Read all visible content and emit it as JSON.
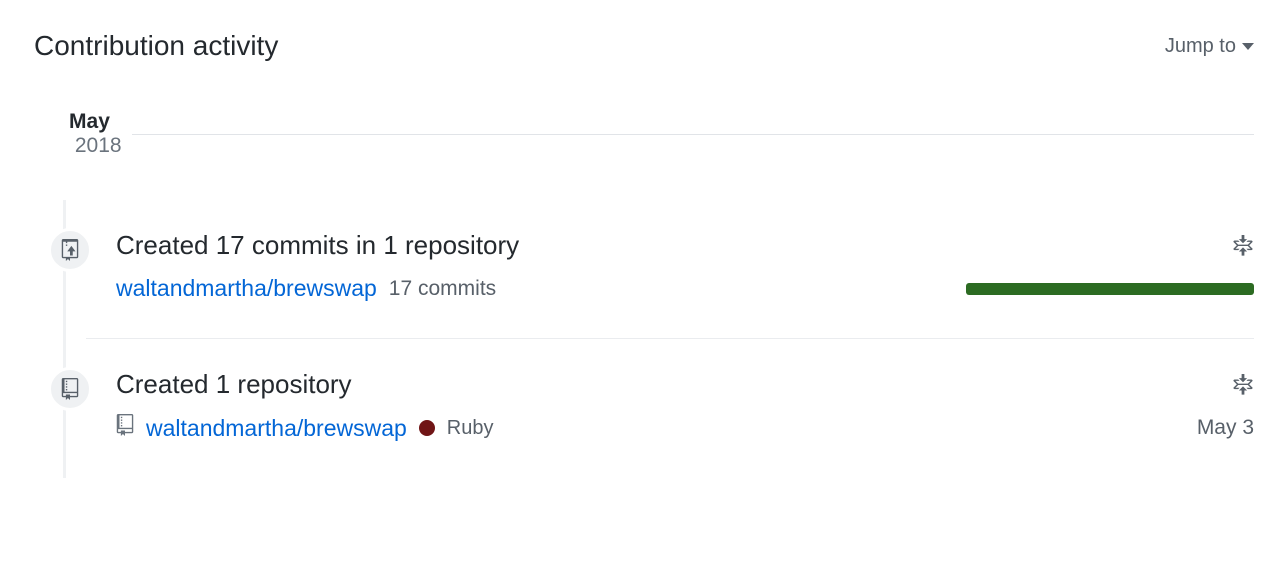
{
  "header": {
    "title": "Contribution activity",
    "jump_to": "Jump to"
  },
  "month": {
    "name": "May",
    "year": "2018"
  },
  "activities": [
    {
      "title": "Created 17 commits in 1 repository",
      "repo": "waltandmartha/brewswap",
      "commits_label": "17 commits"
    },
    {
      "title": "Created 1 repository",
      "repo": "waltandmartha/brewswap",
      "language": "Ruby",
      "language_color": "#701516",
      "date": "May 3"
    }
  ]
}
